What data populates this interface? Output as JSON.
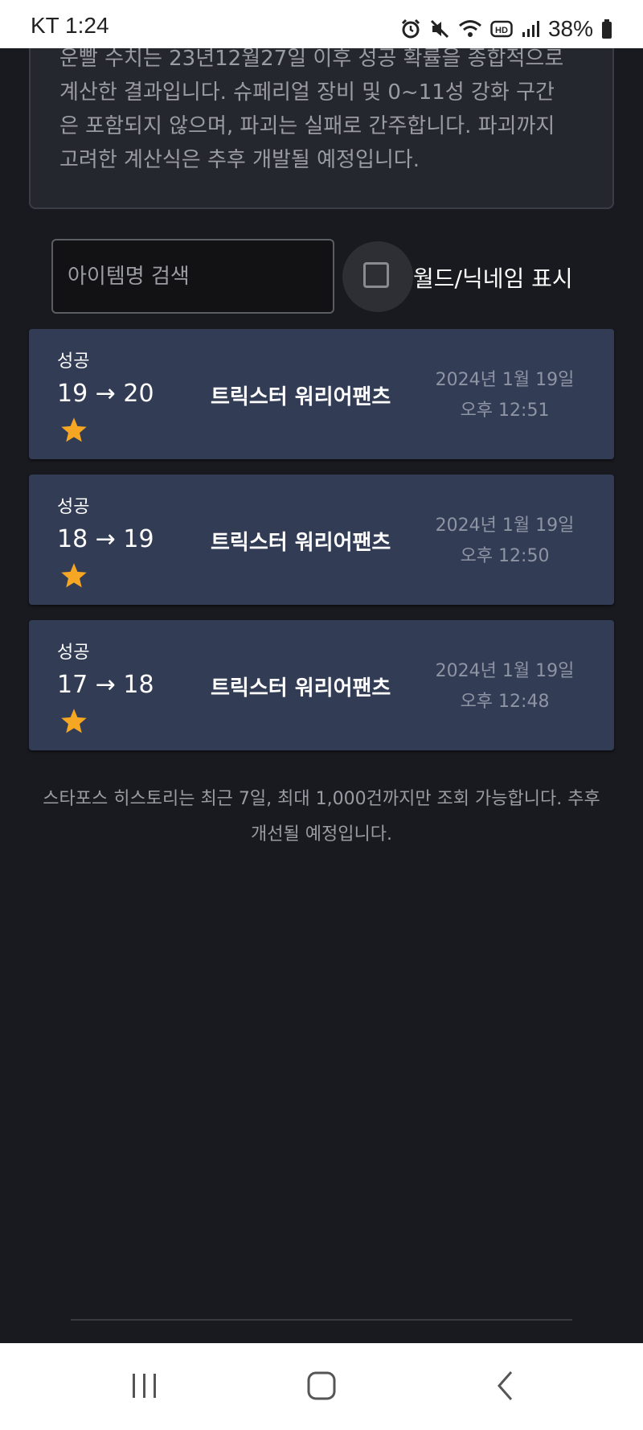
{
  "status_bar": {
    "time": "KT 1:24",
    "battery": "38%",
    "icons": [
      "alarm-icon",
      "mute-icon",
      "wifi-icon",
      "hd-icon",
      "signal-icon",
      "battery-icon"
    ]
  },
  "notice": {
    "text": "운빨 수치는 23년12월27일 이후 성공 확률을 종합적으로\n계산한 결과입니다. 슈페리얼 장비 및 0~11성 강화 구간\n은 포함되지 않으며, 파괴는 실패로 간주합니다. 파괴까지\n고려한 계산식은 추후 개발될 예정입니다."
  },
  "search": {
    "placeholder": "아이템명 검색",
    "value": ""
  },
  "toggle": {
    "label": "월드/닉네임 표시",
    "checked": false
  },
  "history": [
    {
      "result": "성공",
      "from": "19",
      "to": "20",
      "change": "19 → 20",
      "icon": "star-icon",
      "item": "트릭스터 워리어팬츠",
      "date": "2024년 1월 19일",
      "time": "오후 12:51"
    },
    {
      "result": "성공",
      "from": "18",
      "to": "19",
      "change": "18 → 19",
      "icon": "star-icon",
      "item": "트릭스터 워리어팬츠",
      "date": "2024년 1월 19일",
      "time": "오후 12:50"
    },
    {
      "result": "성공",
      "from": "17",
      "to": "18",
      "change": "17 → 18",
      "icon": "star-icon",
      "item": "트릭스터 워리어팬츠",
      "date": "2024년 1월 19일",
      "time": "오후 12:48"
    }
  ],
  "footer_note": "스타포스 히스토리는 최근 7일, 최대 1,000건까지만 조회 가능합니다. 추후\n개선될 예정입니다.",
  "colors": {
    "background": "#191a1f",
    "card": "#323c55",
    "star": "#f5a623",
    "muted_text": "#9a9ca3"
  },
  "nav": {
    "items": [
      "recent-apps-icon",
      "home-icon",
      "back-icon"
    ]
  }
}
